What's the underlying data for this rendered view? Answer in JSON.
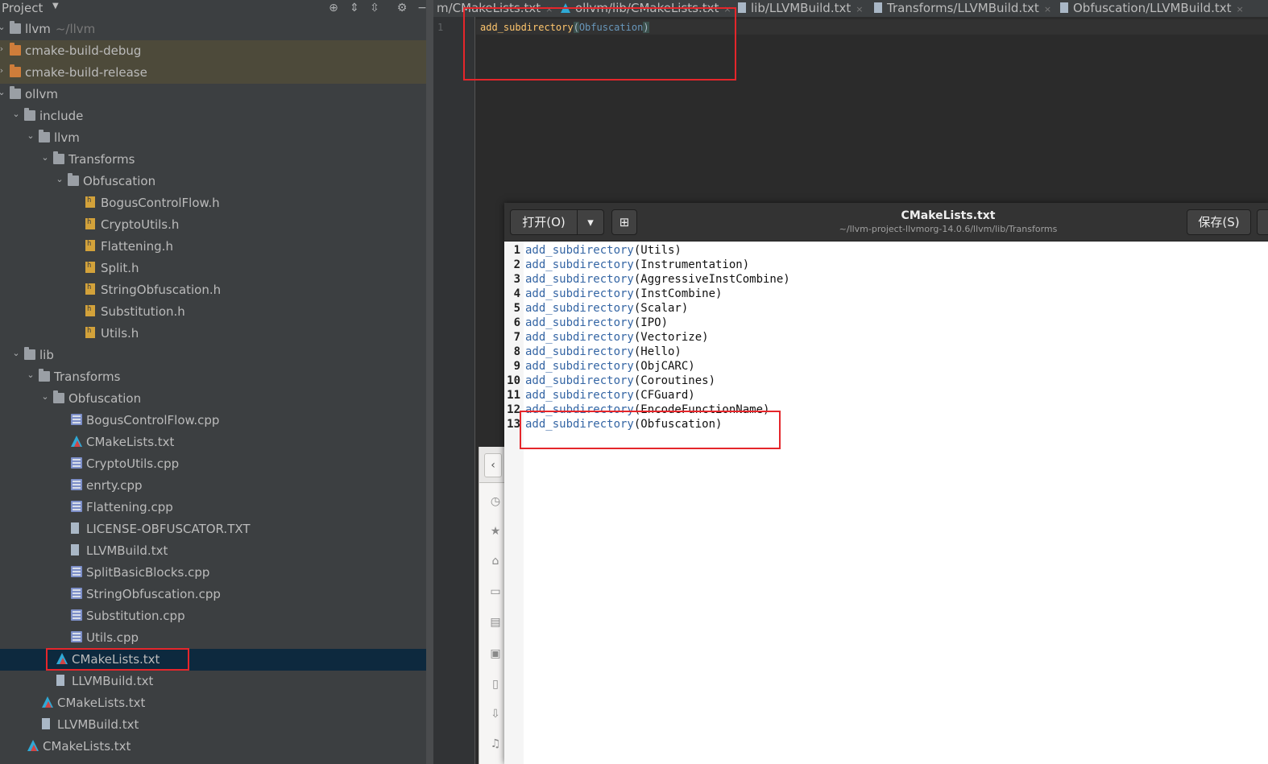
{
  "project_panel": {
    "title": "Project",
    "tree": [
      {
        "label": "llvm",
        "sub": "~/llvm",
        "type": "folder",
        "depth": 0,
        "arrow": "▾",
        "style": "normal"
      },
      {
        "label": "cmake-build-debug",
        "type": "folder-orange",
        "depth": 0,
        "arrow": "›",
        "style": "excluded"
      },
      {
        "label": "cmake-build-release",
        "type": "folder-orange",
        "depth": 0,
        "arrow": "›",
        "style": "excluded"
      },
      {
        "label": "ollvm",
        "type": "folder",
        "depth": 0,
        "arrow": "▾",
        "style": "normal"
      },
      {
        "label": "include",
        "type": "folder",
        "depth": 1,
        "arrow": "⌄",
        "style": "normal"
      },
      {
        "label": "llvm",
        "type": "folder",
        "depth": 2,
        "arrow": "⌄",
        "style": "normal"
      },
      {
        "label": "Transforms",
        "type": "folder",
        "depth": 3,
        "arrow": "⌄",
        "style": "normal"
      },
      {
        "label": "Obfuscation",
        "type": "folder",
        "depth": 4,
        "arrow": "⌄",
        "style": "normal"
      },
      {
        "label": "BogusControlFlow.h",
        "type": "hfile",
        "depth": 5,
        "style": "normal"
      },
      {
        "label": "CryptoUtils.h",
        "type": "hfile",
        "depth": 5,
        "style": "normal"
      },
      {
        "label": "Flattening.h",
        "type": "hfile",
        "depth": 5,
        "style": "normal"
      },
      {
        "label": "Split.h",
        "type": "hfile",
        "depth": 5,
        "style": "normal"
      },
      {
        "label": "StringObfuscation.h",
        "type": "hfile",
        "depth": 5,
        "style": "normal"
      },
      {
        "label": "Substitution.h",
        "type": "hfile",
        "depth": 5,
        "style": "normal"
      },
      {
        "label": "Utils.h",
        "type": "hfile",
        "depth": 5,
        "style": "normal"
      },
      {
        "label": "lib",
        "type": "folder",
        "depth": 1,
        "arrow": "⌄",
        "style": "normal"
      },
      {
        "label": "Transforms",
        "type": "folder",
        "depth": 2,
        "arrow": "⌄",
        "style": "normal"
      },
      {
        "label": "Obfuscation",
        "type": "folder",
        "depth": 3,
        "arrow": "⌄",
        "style": "normal"
      },
      {
        "label": "BogusControlFlow.cpp",
        "type": "cppfile",
        "depth": 4,
        "style": "normal"
      },
      {
        "label": "CMakeLists.txt",
        "type": "cmake",
        "depth": 4,
        "style": "normal"
      },
      {
        "label": "CryptoUtils.cpp",
        "type": "cppfile",
        "depth": 4,
        "style": "normal"
      },
      {
        "label": "enrty.cpp",
        "type": "cppfile",
        "depth": 4,
        "style": "normal"
      },
      {
        "label": "Flattening.cpp",
        "type": "cppfile",
        "depth": 4,
        "style": "normal"
      },
      {
        "label": "LICENSE-OBFUSCATOR.TXT",
        "type": "txtfile",
        "depth": 4,
        "style": "normal"
      },
      {
        "label": "LLVMBuild.txt",
        "type": "txtfile",
        "depth": 4,
        "style": "normal"
      },
      {
        "label": "SplitBasicBlocks.cpp",
        "type": "cppfile",
        "depth": 4,
        "style": "normal"
      },
      {
        "label": "StringObfuscation.cpp",
        "type": "cppfile",
        "depth": 4,
        "style": "normal"
      },
      {
        "label": "Substitution.cpp",
        "type": "cppfile",
        "depth": 4,
        "style": "normal"
      },
      {
        "label": "Utils.cpp",
        "type": "cppfile",
        "depth": 4,
        "style": "normal"
      },
      {
        "label": "CMakeLists.txt",
        "type": "cmake",
        "depth": 3,
        "style": "selected"
      },
      {
        "label": "LLVMBuild.txt",
        "type": "txtfile",
        "depth": 3,
        "style": "normal"
      },
      {
        "label": "CMakeLists.txt",
        "type": "cmake",
        "depth": 2,
        "style": "normal"
      },
      {
        "label": "LLVMBuild.txt",
        "type": "txtfile",
        "depth": 2,
        "style": "normal"
      },
      {
        "label": "CMakeLists.txt",
        "type": "cmake",
        "depth": 1,
        "style": "normal"
      }
    ]
  },
  "editor": {
    "tabs": [
      {
        "label": "m/CMakeLists.txt",
        "icon": "none"
      },
      {
        "label": "ollvm/lib/CMakeLists.txt",
        "icon": "cmake"
      },
      {
        "label": "lib/LLVMBuild.txt",
        "icon": "txt"
      },
      {
        "label": "Transforms/LLVMBuild.txt",
        "icon": "txt"
      },
      {
        "label": "Obfuscation/LLVMBuild.txt",
        "icon": "txt"
      }
    ],
    "line_number": "1",
    "code_keyword": "add_subdirectory",
    "code_open": "(",
    "code_arg": "Obfuscation",
    "code_close": ")"
  },
  "gedit": {
    "open_label": "打开(O)",
    "save_label": "保存(S)",
    "title": "CMakeLists.txt",
    "path": "~/llvm-project-llvmorg-14.0.6/llvm/lib/Transforms",
    "lines": [
      {
        "n": "1",
        "kw": "add_subdirectory",
        "arg": "(Utils)"
      },
      {
        "n": "2",
        "kw": "add_subdirectory",
        "arg": "(Instrumentation)"
      },
      {
        "n": "3",
        "kw": "add_subdirectory",
        "arg": "(AggressiveInstCombine)"
      },
      {
        "n": "4",
        "kw": "add_subdirectory",
        "arg": "(InstCombine)"
      },
      {
        "n": "5",
        "kw": "add_subdirectory",
        "arg": "(Scalar)"
      },
      {
        "n": "6",
        "kw": "add_subdirectory",
        "arg": "(IPO)"
      },
      {
        "n": "7",
        "kw": "add_subdirectory",
        "arg": "(Vectorize)"
      },
      {
        "n": "8",
        "kw": "add_subdirectory",
        "arg": "(Hello)"
      },
      {
        "n": "9",
        "kw": "add_subdirectory",
        "arg": "(ObjCARC)"
      },
      {
        "n": "10",
        "kw": "add_subdirectory",
        "arg": "(Coroutines)"
      },
      {
        "n": "11",
        "kw": "add_subdirectory",
        "arg": "(CFGuard)"
      },
      {
        "n": "12",
        "kw": "add_subdirectory",
        "arg": "(EncodeFunctionName)"
      },
      {
        "n": "13",
        "kw": "add_subdirectory",
        "arg": "(Obfuscation)"
      }
    ]
  },
  "colors": {
    "highlight_box": "#e5262b",
    "selected_row": "#0d293e",
    "keyword_blue": "#3465a4"
  }
}
